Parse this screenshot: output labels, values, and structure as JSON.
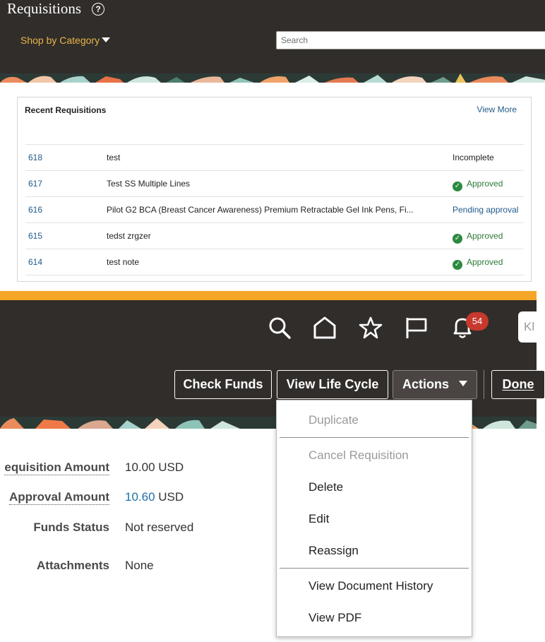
{
  "header": {
    "title": "Requisitions",
    "help_glyph": "?",
    "shop_by_category": "Shop by Category",
    "search_placeholder": "Search"
  },
  "recent_requisitions": {
    "title": "Recent Requisitions",
    "view_more": "View More",
    "rows": [
      {
        "id": "618",
        "description": "test",
        "status": "Incomplete",
        "status_type": "plain"
      },
      {
        "id": "617",
        "description": "Test SS Multiple Lines",
        "status": "Approved",
        "status_type": "approved"
      },
      {
        "id": "616",
        "description": "Pilot G2 BCA (Breast Cancer Awareness) Premium Retractable Gel Ink Pens, Fi...",
        "status": "Pending approval",
        "status_type": "pending"
      },
      {
        "id": "615",
        "description": "tedst zrgzer",
        "status": "Approved",
        "status_type": "approved"
      },
      {
        "id": "614",
        "description": "test note",
        "status": "Approved",
        "status_type": "approved"
      }
    ]
  },
  "global_nav": {
    "notification_count": "54",
    "user_initials": "Kl"
  },
  "toolbar": {
    "check_funds": "Check Funds",
    "view_life_cycle": "View Life Cycle",
    "actions": "Actions",
    "done": "Done"
  },
  "details": {
    "requisition_amount_label": "equisition Amount",
    "requisition_amount_value": "10.00",
    "requisition_amount_currency": "USD",
    "approval_amount_label": "Approval Amount",
    "approval_amount_value": "10.60",
    "approval_amount_currency": "USD",
    "funds_status_label": "Funds Status",
    "funds_status_value": "Not reserved",
    "attachments_label": "Attachments",
    "attachments_value": "None"
  },
  "actions_menu": {
    "duplicate": "Duplicate",
    "cancel_requisition": "Cancel Requisition",
    "delete": "Delete",
    "edit": "Edit",
    "reassign": "Reassign",
    "view_document_history": "View Document History",
    "view_pdf": "View PDF"
  },
  "colors": {
    "header_bg": "#312d2a",
    "accent_orange": "#f5a626",
    "link_blue": "#1f5a8a",
    "approved_green": "#2d8a3e",
    "badge_red": "#c7382d"
  }
}
